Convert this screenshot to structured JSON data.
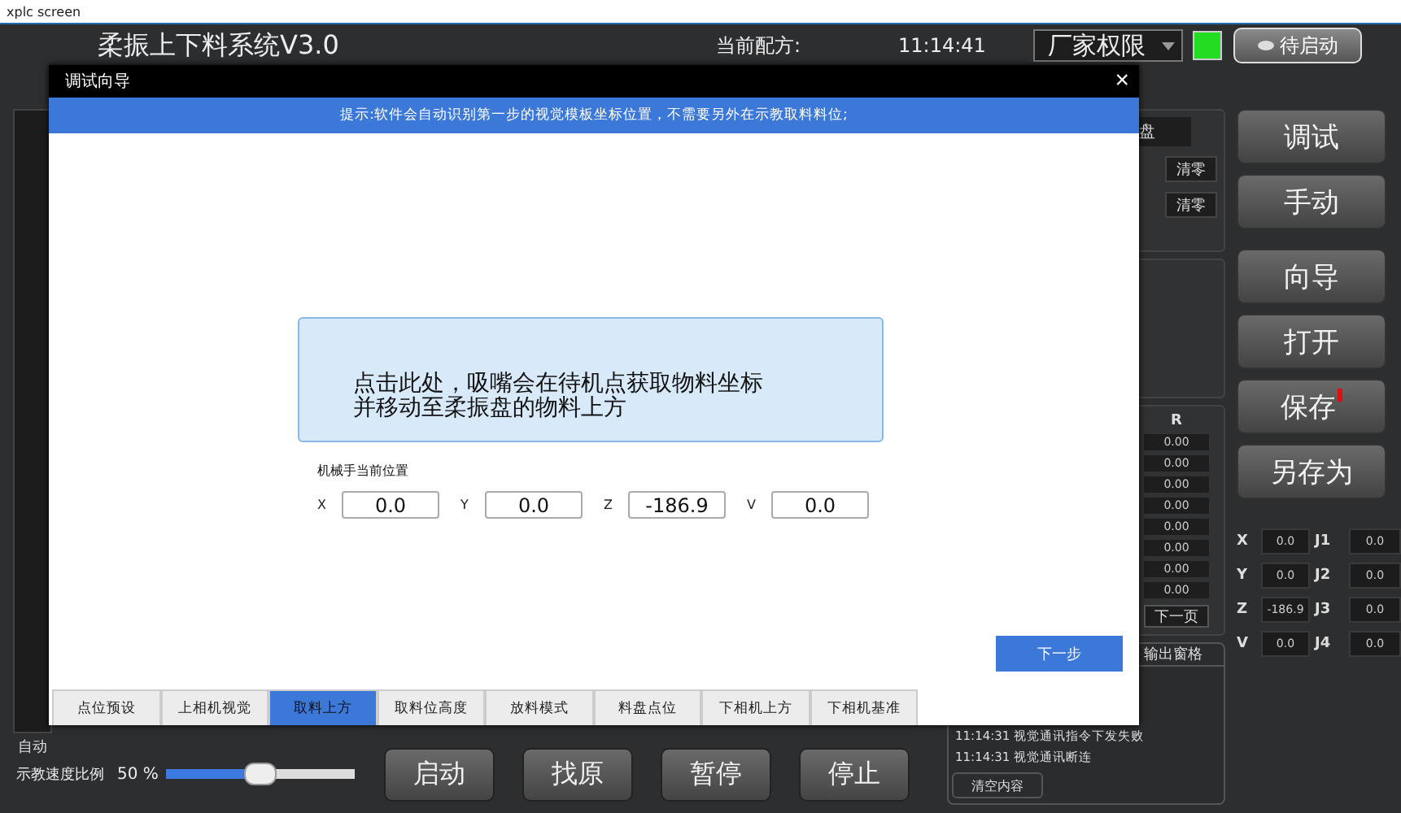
{
  "window": {
    "title": "xplc screen"
  },
  "header": {
    "app_title": "柔振上下料系统V3.0",
    "recipe_label": "当前配方:",
    "time": "11:14:41",
    "permission": "厂家权限",
    "status_on": true,
    "status_button": "待启动"
  },
  "left_panel": {
    "mode": "自动"
  },
  "side_buttons": [
    {
      "label": "调试",
      "alert": false
    },
    {
      "label": "手动",
      "alert": false
    },
    {
      "label": "向导",
      "alert": false
    },
    {
      "label": "打开",
      "alert": false
    },
    {
      "label": "保存",
      "alert": true
    },
    {
      "label": "另存为",
      "alert": false
    }
  ],
  "axes": [
    {
      "axis": "X",
      "value": "0.0",
      "joint": "J1",
      "joint_value": "0.0"
    },
    {
      "axis": "Y",
      "value": "0.0",
      "joint": "J2",
      "joint_value": "0.0"
    },
    {
      "axis": "Z",
      "value": "-186.9",
      "joint": "J3",
      "joint_value": "0.0"
    },
    {
      "axis": "V",
      "value": "0.0",
      "joint": "J4",
      "joint_value": "0.0"
    }
  ],
  "tray_panel": {
    "label": "盘",
    "clear_buttons": [
      "清零",
      "清零"
    ]
  },
  "r_table": {
    "heading": "R",
    "values": [
      "0.00",
      "0.00",
      "0.00",
      "0.00",
      "0.00",
      "0.00",
      "0.00",
      "0.00"
    ],
    "next_page": "下一页"
  },
  "output": {
    "title": "输出窗格",
    "lines": [
      "11:14:31  视觉通讯指令下发失败",
      "11:14:31  视觉通讯断连"
    ],
    "clear": "清空内容"
  },
  "speed": {
    "label": "示教速度比例",
    "reading": "50 %",
    "level": 0.5
  },
  "control_buttons": [
    "启动",
    "找原",
    "暂停",
    "停止"
  ],
  "dialog": {
    "title": "调试向导",
    "close": "×",
    "hint": "提示:软件会自动识别第一步的视觉模板坐标位置，不需要另外在示教取料料位;",
    "action_card": "点击此处，吸嘴会在待机点获取物料坐标并移动至柔振盘的物料上方",
    "position_label": "机械手当前位置",
    "fields": [
      {
        "label": "X",
        "value": "0.0"
      },
      {
        "label": "Y",
        "value": "0.0"
      },
      {
        "label": "Z",
        "value": "-186.9"
      },
      {
        "label": "V",
        "value": "0.0"
      }
    ],
    "next": "下一步",
    "tabs": [
      {
        "label": "点位预设",
        "selected": false
      },
      {
        "label": "上相机视觉",
        "selected": false
      },
      {
        "label": "取料上方",
        "selected": true
      },
      {
        "label": "取料位高度",
        "selected": false
      },
      {
        "label": "放料模式",
        "selected": false
      },
      {
        "label": "料盘点位",
        "selected": false
      },
      {
        "label": "下相机上方",
        "selected": false
      },
      {
        "label": "下相机基准",
        "selected": false
      }
    ]
  }
}
